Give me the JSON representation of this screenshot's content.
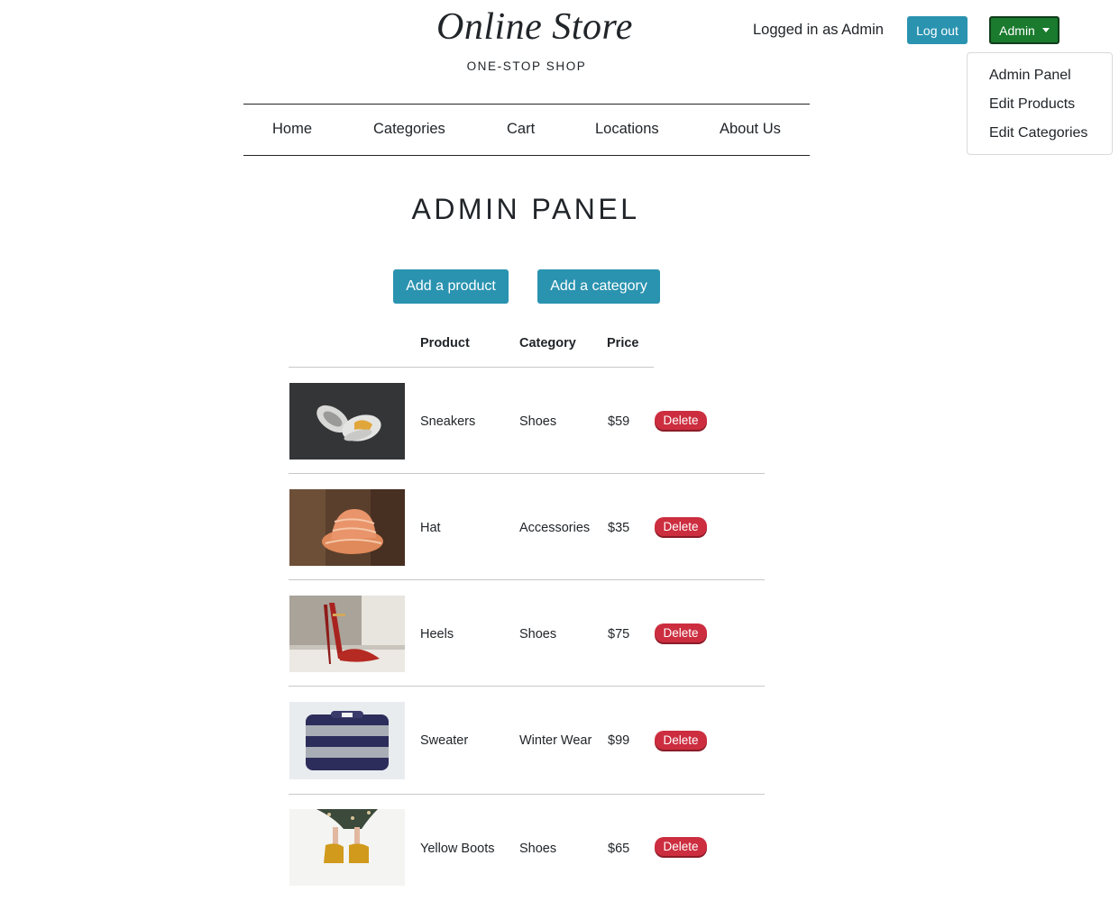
{
  "header": {
    "title": "Online Store",
    "subtitle": "ONE-STOP SHOP",
    "logged_in_text": "Logged in as Admin",
    "logout_label": "Log out",
    "admin_menu_label": "Admin"
  },
  "admin_dropdown": {
    "items": [
      "Admin Panel",
      "Edit Products",
      "Edit Categories"
    ]
  },
  "nav": {
    "items": [
      "Home",
      "Categories",
      "Cart",
      "Locations",
      "About Us"
    ]
  },
  "page": {
    "title": "ADMIN PANEL",
    "add_product_label": "Add a product",
    "add_category_label": "Add a category"
  },
  "table": {
    "headers": [
      "Product",
      "Category",
      "Price"
    ],
    "delete_label": "Delete",
    "rows": [
      {
        "product": "Sneakers",
        "category": "Shoes",
        "price": "$59"
      },
      {
        "product": "Hat",
        "category": "Accessories",
        "price": "$35"
      },
      {
        "product": "Heels",
        "category": "Shoes",
        "price": "$75"
      },
      {
        "product": "Sweater",
        "category": "Winter Wear",
        "price": "$99"
      },
      {
        "product": "Yellow Boots",
        "category": "Shoes",
        "price": "$65"
      }
    ]
  },
  "colors": {
    "primary": "#2a93b0",
    "admin_button": "#1a7a2e",
    "danger": "#cc2e3f"
  }
}
